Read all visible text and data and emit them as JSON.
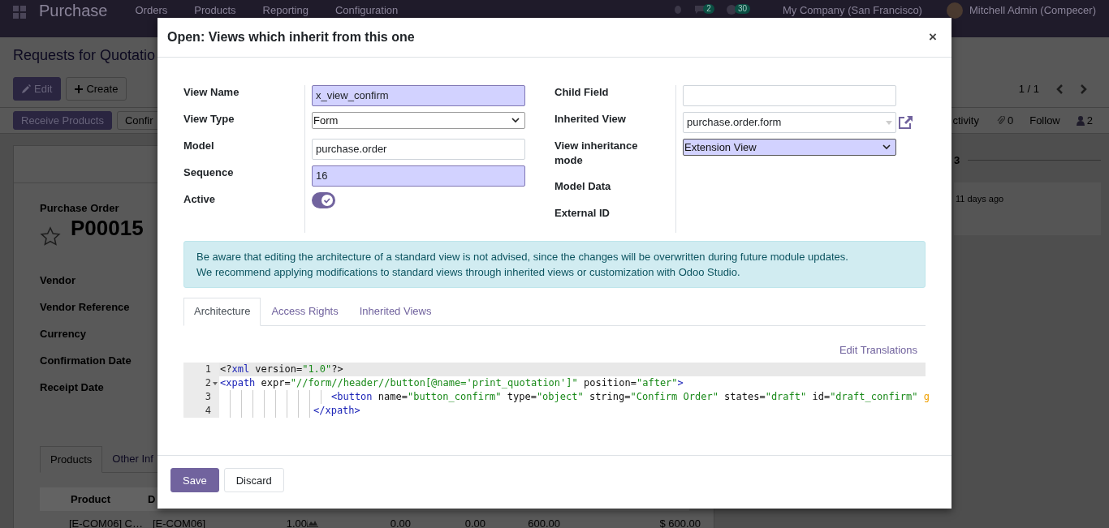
{
  "navbar": {
    "app_name": "Purchase",
    "menu": [
      "Orders",
      "Products",
      "Reporting",
      "Configuration"
    ],
    "badges": [
      "2",
      "30"
    ],
    "company": "My Company (San Francisco)",
    "user": "Mitchell Admin (Compecer)"
  },
  "control_panel": {
    "title": "Requests for Quotatio",
    "buttons": [
      {
        "label": "Edit",
        "kind": "primary"
      },
      {
        "label": "Create",
        "kind": "secondary"
      }
    ],
    "pager": "1 / 1",
    "status_buttons": [
      {
        "label": "Receive Products",
        "kind": "primary"
      },
      {
        "label": "Confir",
        "kind": "secondary"
      }
    ],
    "chatter_bar": {
      "activity": "ctivity",
      "attachments": "0",
      "follow": "Follow",
      "followers": "2"
    }
  },
  "sheet": {
    "subtitle": "Purchase Order",
    "name": "P00015",
    "starred": false,
    "fields": [
      "Vendor",
      "Vendor Reference",
      "Currency",
      "Confirmation Date",
      "Receipt Date"
    ],
    "tabs": [
      {
        "label": "Products",
        "selected": true
      },
      {
        "label": "Other Inf",
        "selected": false
      }
    ],
    "table": {
      "columns": [
        "Product",
        "D"
      ],
      "rows": [
        {
          "cells": [
            "[E-COM06] C…",
            "[E-COM06]",
            "1.00",
            "0.00",
            "0.00",
            "600.00",
            "$ 600.00"
          ]
        }
      ]
    }
  },
  "chatter": {
    "date_separator": "3",
    "message_time": "11 days ago"
  },
  "modal": {
    "title": "Open: Views which inherit from this one",
    "close": "×",
    "left_fields": [
      {
        "label": "View Name",
        "kind": "input",
        "value": "x_view_confirm",
        "required": true
      },
      {
        "label": "View Type",
        "kind": "select",
        "value": "Form",
        "required": false
      },
      {
        "label": "Model",
        "kind": "input",
        "value": "purchase.order",
        "required": false
      },
      {
        "label": "Sequence",
        "kind": "input",
        "value": "16",
        "required": true
      },
      {
        "label": "Active",
        "kind": "toggle",
        "on": true
      }
    ],
    "right_fields": [
      {
        "label": "Child Field",
        "kind": "input",
        "required": false
      },
      {
        "label": "Inherited View",
        "kind": "many2one",
        "value": "purchase.order.form",
        "required": false
      },
      {
        "label": "View inheritance mode",
        "kind": "select",
        "value": "Extension View",
        "required": true
      },
      {
        "label": "Model Data",
        "kind": "none"
      },
      {
        "label": "External ID",
        "kind": "none"
      }
    ],
    "alert": [
      "Be aware that editing the architecture of a standard view is not advised, since the changes will be overwritten during future module updates.",
      "We recommend applying modifications to standard views through inherited views or customization with Odoo Studio."
    ],
    "tabs": [
      {
        "label": "Architecture",
        "selected": true
      },
      {
        "label": "Access Rights",
        "selected": false
      },
      {
        "label": "Inherited Views",
        "selected": false
      }
    ],
    "edit_translations": "Edit Translations",
    "code": [
      {
        "number": "1",
        "active": true,
        "foldable": false,
        "kind": "top",
        "tokens": [
          {
            "text": "<?",
            "kind": "punct"
          },
          {
            "text": "xml",
            "kind": "tag"
          },
          {
            "text": " version=",
            "kind": "attr"
          },
          {
            "text": "\"1.0\"",
            "kind": "str"
          },
          {
            "text": "?>",
            "kind": "punct"
          }
        ]
      },
      {
        "number": "2",
        "active": false,
        "foldable": true,
        "kind": "top",
        "tokens": [
          {
            "text": "<xpath",
            "kind": "tag"
          },
          {
            "text": " expr=",
            "kind": "attr"
          },
          {
            "text": "\"//form//header//button[@name='print_quotation']\"",
            "kind": "str"
          },
          {
            "text": " position=",
            "kind": "attr"
          },
          {
            "text": "\"after\"",
            "kind": "str"
          },
          {
            "text": ">",
            "kind": "tag"
          }
        ]
      },
      {
        "number": "3",
        "active": false,
        "foldable": false,
        "kind": "child",
        "tokens": [
          {
            "text": "<button",
            "kind": "tag"
          },
          {
            "text": " name=",
            "kind": "attr"
          },
          {
            "text": "\"button_confirm\"",
            "kind": "str"
          },
          {
            "text": " type=",
            "kind": "attr"
          },
          {
            "text": "\"object\"",
            "kind": "str"
          },
          {
            "text": " string=",
            "kind": "attr"
          },
          {
            "text": "\"Confirm Order\"",
            "kind": "str"
          },
          {
            "text": " states=",
            "kind": "attr"
          },
          {
            "text": "\"draft\"",
            "kind": "str"
          },
          {
            "text": " id=",
            "kind": "attr"
          },
          {
            "text": "\"draft_confirm\"",
            "kind": "str"
          },
          {
            "text": " g",
            "kind": "warn"
          }
        ]
      },
      {
        "number": "4",
        "active": false,
        "foldable": false,
        "kind": "close",
        "tokens": [
          {
            "text": "</xpath>",
            "kind": "tag"
          }
        ]
      }
    ],
    "buttons": [
      {
        "label": "Save",
        "kind": "primary"
      },
      {
        "label": "Discard",
        "kind": "secondary"
      }
    ]
  }
}
